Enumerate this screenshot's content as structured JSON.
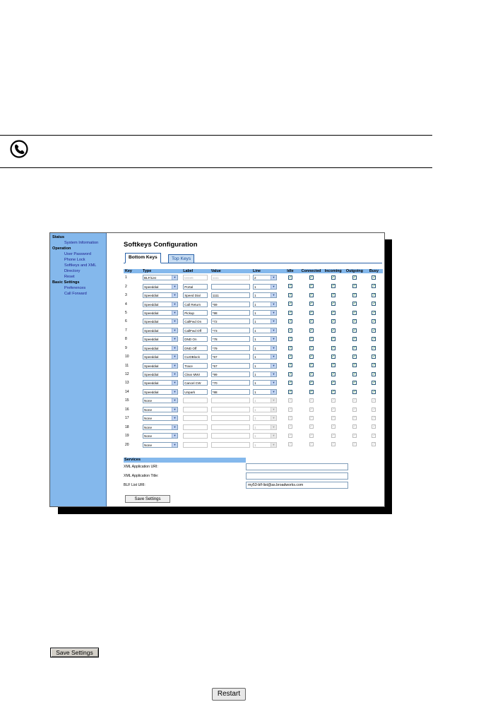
{
  "sidebar": {
    "sections": [
      {
        "heading": "Status",
        "items": [
          "System Information"
        ]
      },
      {
        "heading": "Operation",
        "items": [
          "User Password",
          "Phone Lock",
          "Softkeys and XML",
          "Directory",
          "Reset"
        ]
      },
      {
        "heading": "Basic Settings",
        "items": [
          "Preferences",
          "Call Forward"
        ]
      }
    ]
  },
  "page": {
    "title": "Softkeys Configuration",
    "tabs": [
      {
        "label": "Bottom Keys",
        "active": true
      },
      {
        "label": "Top Keys",
        "active": false
      }
    ]
  },
  "table": {
    "headers": [
      "Key",
      "Type",
      "Label",
      "Value",
      "Line",
      "Idle",
      "Connected",
      "Incoming",
      "Outgoing",
      "Busy"
    ],
    "rows": [
      {
        "key": "1",
        "type": "BLF/List",
        "label": "testett",
        "value": "1111",
        "line": "2",
        "enabled": true,
        "label_disabled": true,
        "value_disabled": true,
        "states": [
          true,
          true,
          true,
          true,
          true
        ]
      },
      {
        "key": "2",
        "type": "Speeddial",
        "label": "Portal",
        "value": "",
        "line": "1",
        "enabled": true,
        "states": [
          true,
          true,
          true,
          true,
          true
        ]
      },
      {
        "key": "3",
        "type": "Speeddial",
        "label": "Speed Dial",
        "value": "1111",
        "line": "1",
        "enabled": true,
        "states": [
          true,
          true,
          true,
          true,
          true
        ]
      },
      {
        "key": "4",
        "type": "Speeddial",
        "label": "Call Return",
        "value": "*69",
        "line": "1",
        "enabled": true,
        "states": [
          true,
          true,
          true,
          true,
          true
        ]
      },
      {
        "key": "5",
        "type": "Speeddial",
        "label": "Pickup",
        "value": "*98",
        "line": "1",
        "enabled": true,
        "states": [
          true,
          true,
          true,
          true,
          true
        ]
      },
      {
        "key": "6",
        "type": "Speeddial",
        "label": "CallFwd On",
        "value": "*72",
        "line": "1",
        "enabled": true,
        "states": [
          true,
          true,
          true,
          true,
          true
        ]
      },
      {
        "key": "7",
        "type": "Speeddial",
        "label": "CallFwd Off",
        "value": "*73",
        "line": "1",
        "enabled": true,
        "states": [
          true,
          true,
          true,
          true,
          true
        ]
      },
      {
        "key": "8",
        "type": "Speeddial",
        "label": "DND On",
        "value": "*78",
        "line": "1",
        "enabled": true,
        "states": [
          true,
          true,
          true,
          true,
          true
        ]
      },
      {
        "key": "9",
        "type": "Speeddial",
        "label": "DND Off",
        "value": "*79",
        "line": "1",
        "enabled": true,
        "states": [
          true,
          true,
          true,
          true,
          true
        ]
      },
      {
        "key": "10",
        "type": "Speeddial",
        "label": "CLIDBlock",
        "value": "*67",
        "line": "1",
        "enabled": true,
        "states": [
          true,
          true,
          true,
          true,
          true
        ]
      },
      {
        "key": "11",
        "type": "Speeddial",
        "label": "Trace",
        "value": "*57",
        "line": "1",
        "enabled": true,
        "states": [
          true,
          true,
          true,
          true,
          true
        ]
      },
      {
        "key": "12",
        "type": "Speeddial",
        "label": "Clear MWI",
        "value": "*99",
        "line": "1",
        "enabled": true,
        "states": [
          true,
          true,
          true,
          true,
          true
        ]
      },
      {
        "key": "13",
        "type": "Speeddial",
        "label": "Cancel CW",
        "value": "*70",
        "line": "1",
        "enabled": true,
        "states": [
          true,
          true,
          true,
          true,
          true
        ]
      },
      {
        "key": "14",
        "type": "Speeddial",
        "label": "Unpark",
        "value": "*88",
        "line": "1",
        "enabled": true,
        "states": [
          true,
          true,
          true,
          true,
          true
        ]
      },
      {
        "key": "15",
        "type": "None",
        "label": "",
        "value": "",
        "line": "1",
        "enabled": false,
        "states": [
          true,
          true,
          true,
          true,
          true
        ]
      },
      {
        "key": "16",
        "type": "None",
        "label": "",
        "value": "",
        "line": "1",
        "enabled": false,
        "states": [
          true,
          true,
          true,
          true,
          true
        ]
      },
      {
        "key": "17",
        "type": "None",
        "label": "",
        "value": "",
        "line": "1",
        "enabled": false,
        "states": [
          true,
          true,
          true,
          true,
          true
        ]
      },
      {
        "key": "18",
        "type": "None",
        "label": "",
        "value": "",
        "line": "1",
        "enabled": false,
        "states": [
          true,
          true,
          true,
          true,
          true
        ]
      },
      {
        "key": "19",
        "type": "None",
        "label": "",
        "value": "",
        "line": "1",
        "enabled": false,
        "states": [
          true,
          true,
          true,
          true,
          true
        ]
      },
      {
        "key": "20",
        "type": "None",
        "label": "",
        "value": "",
        "line": "1",
        "enabled": false,
        "states": [
          true,
          true,
          true,
          true,
          true
        ]
      }
    ]
  },
  "services": {
    "heading": "Services",
    "fields": [
      {
        "label": "XML Application URI:",
        "value": ""
      },
      {
        "label": "XML Application Title:",
        "value": ""
      },
      {
        "label": "BLF List URI:",
        "value": "my53-blf-list@as.broadworks.com"
      }
    ],
    "save_label": "Save Settings"
  },
  "buttons": {
    "save_settings": "Save Settings",
    "restart": "Restart"
  },
  "icons": {
    "note": "telephone-note-icon",
    "dropdown_arrow": "▼",
    "checkmark": "✓"
  }
}
